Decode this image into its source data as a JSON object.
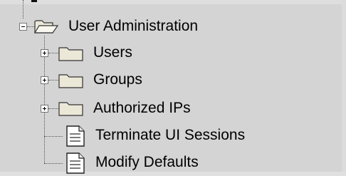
{
  "tree": {
    "root": {
      "label": "User Administration",
      "state": "expanded",
      "icon": "folder-open-icon",
      "children": [
        {
          "label": "Users",
          "type": "folder",
          "state": "collapsed",
          "icon": "folder-icon"
        },
        {
          "label": "Groups",
          "type": "folder",
          "state": "collapsed",
          "icon": "folder-icon"
        },
        {
          "label": "Authorized IPs",
          "type": "folder",
          "state": "collapsed",
          "icon": "folder-icon"
        },
        {
          "label": "Terminate UI Sessions",
          "type": "document",
          "icon": "document-icon"
        },
        {
          "label": "Modify Defaults",
          "type": "document",
          "icon": "document-icon"
        }
      ]
    }
  },
  "colors": {
    "background": "#d4d4d4",
    "folder_fill": "#ece8d8",
    "tree_lines": "#555555"
  }
}
